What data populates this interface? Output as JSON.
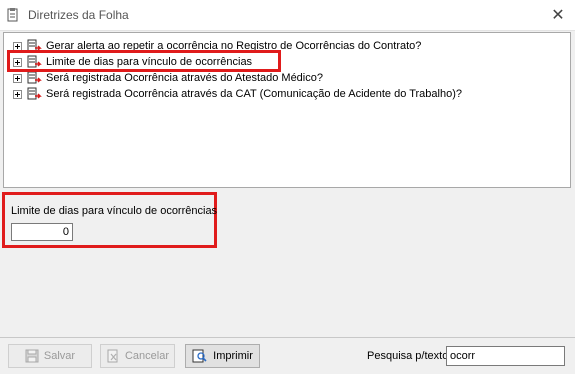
{
  "window": {
    "title": "Diretrizes da Folha",
    "close_symbol": "✕"
  },
  "tree": {
    "items": [
      {
        "label": "Gerar alerta ao repetir a ocorrência no Registro de Ocorrências do Contrato?",
        "icon": "document-arrow-icon"
      },
      {
        "label": "Limite de dias para vínculo de ocorrências",
        "icon": "document-arrow-icon"
      },
      {
        "label": "Será registrada Ocorrência através do Atestado Médico?",
        "icon": "document-arrow-icon"
      },
      {
        "label": "Será registrada Ocorrência através da CAT (Comunicação de Acidente do Trabalho)?",
        "icon": "document-arrow-icon"
      }
    ]
  },
  "detail": {
    "label": "Limite de dias para vínculo de ocorrências",
    "value": "0"
  },
  "toolbar": {
    "save_label": "Salvar",
    "cancel_label": "Cancelar",
    "print_label": "Imprimir",
    "search_label": "Pesquisa p/texto:",
    "search_value": "ocorr"
  },
  "colors": {
    "highlight": "#e01b1b",
    "icon_arrow": "#d61a1a"
  }
}
